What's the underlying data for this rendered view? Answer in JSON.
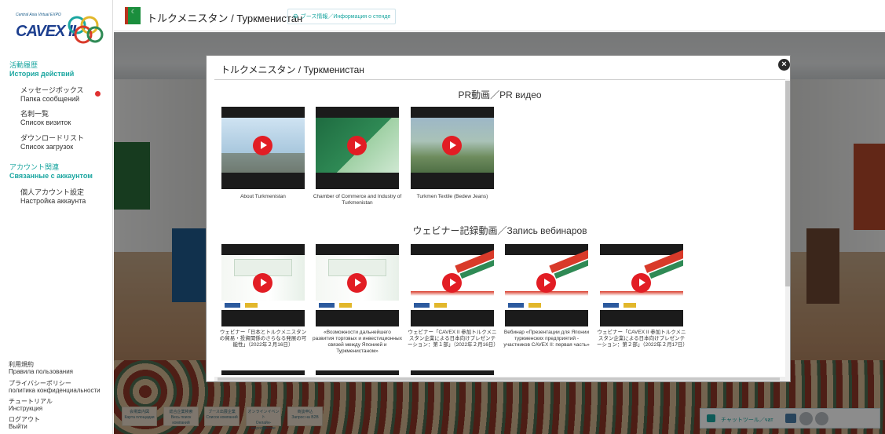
{
  "sidebar": {
    "logo": {
      "subtitle": "Central Asia Virtual EXPO",
      "wordmark": "CAVEX II"
    },
    "activity": {
      "jp": "活動履歴",
      "ru": "История действий"
    },
    "items": [
      {
        "jp": "メッセージボックス",
        "ru": "Папка сообщений"
      },
      {
        "jp": "名刺一覧",
        "ru": "Список визиток"
      },
      {
        "jp": "ダウンロードリスト",
        "ru": "Список загрузок"
      }
    ],
    "account": {
      "jp": "アカウント関連",
      "ru": "Связанные с аккаунтом"
    },
    "account_items": [
      {
        "jp": "個人アカウント設定",
        "ru": "Настройка аккаунта"
      }
    ],
    "footer": [
      {
        "jp": "利用規約",
        "ru": "Правила пользования"
      },
      {
        "jp": "プライバシーポリシー",
        "ru": "политика конфиденциальности"
      },
      {
        "jp": "チュートリアル",
        "ru": "Инструкция"
      },
      {
        "jp": "ログアウト",
        "ru": "Выйти"
      }
    ]
  },
  "topbar": {
    "title": "トルクメニスタン / Туркменистан",
    "info_button": "ブース情報／Информация о стенде"
  },
  "modal": {
    "title": "トルクメニスタン / Туркменистан",
    "pr_heading": "PR動画／PR видео",
    "pr_videos": [
      {
        "caption": "About Turkmenistan"
      },
      {
        "caption": "Chamber of Commerce and Industry of Turkmenistan"
      },
      {
        "caption": "Turkmen Textile (Bedew Jeans)"
      }
    ],
    "webinar_heading": "ウェビナー記録動画／Запись вебинаров",
    "webinar_videos": [
      {
        "caption": "ウェビナー「日本とトルクメニスタンの貿易・投資関係のさらなる発展の可能性」（2022年２月16日）"
      },
      {
        "caption": "«Возможности дальнейшего развития торговых и инвестиционных связей между Японией и Туркменистаном»"
      },
      {
        "caption": "ウェビナー「CAVEX II 参加トルクメニスタン企業による日本向けプレゼンテーション：第１部」（2022年２月16日）"
      },
      {
        "caption": "Вебинар «Презентации для Японии туркменских предприятий - участников CAVEX II: первая часть»"
      },
      {
        "caption": "ウェビナー「CAVEX II 参加トルクメニスタン企業による日本向けプレゼンテーション：第２部」（2022年２月17日）"
      }
    ]
  },
  "bottom_buttons": [
    {
      "jp": "会場案内図",
      "ru": "Карта площадки"
    },
    {
      "jp": "総合企業検索",
      "ru": "Весь поиск компаний"
    },
    {
      "jp": "ブース出展企業",
      "ru": "Список компаний"
    },
    {
      "jp": "オンラインイベント",
      "ru": "Онлайн-мероприятие"
    },
    {
      "jp": "商談申込",
      "ru": "Запрос на B2B"
    }
  ],
  "chat": {
    "label": "チャットツール／чат"
  },
  "colors": {
    "accent": "#1aa6a0",
    "play": "#e21d24",
    "brand": "#1d3f8f"
  }
}
